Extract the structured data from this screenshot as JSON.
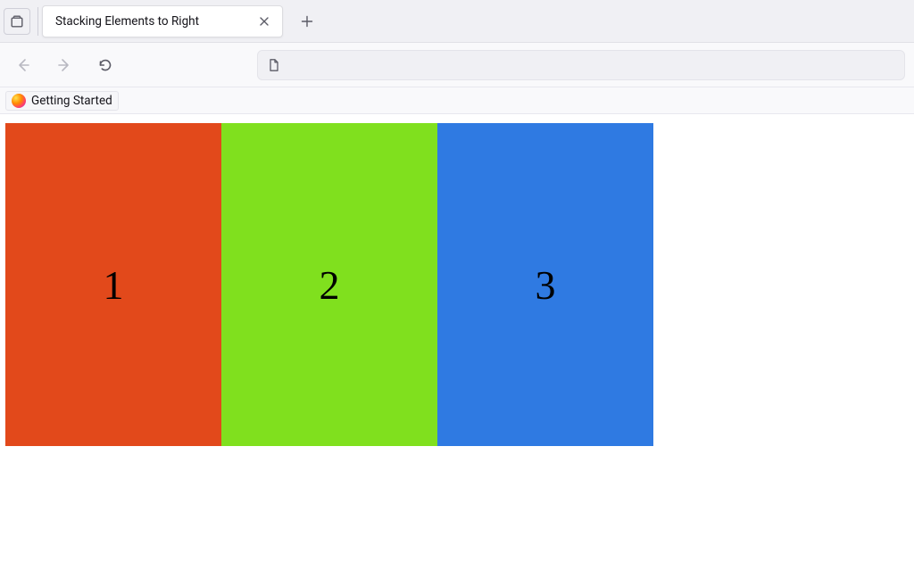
{
  "browser": {
    "tab_title": "Stacking Elements to Right",
    "bookmarks": [
      {
        "label": "Getting Started"
      }
    ]
  },
  "page": {
    "boxes": [
      {
        "label": "1",
        "color": "#e2491b"
      },
      {
        "label": "2",
        "color": "#80e01e"
      },
      {
        "label": "3",
        "color": "#2f7ae2"
      }
    ]
  }
}
